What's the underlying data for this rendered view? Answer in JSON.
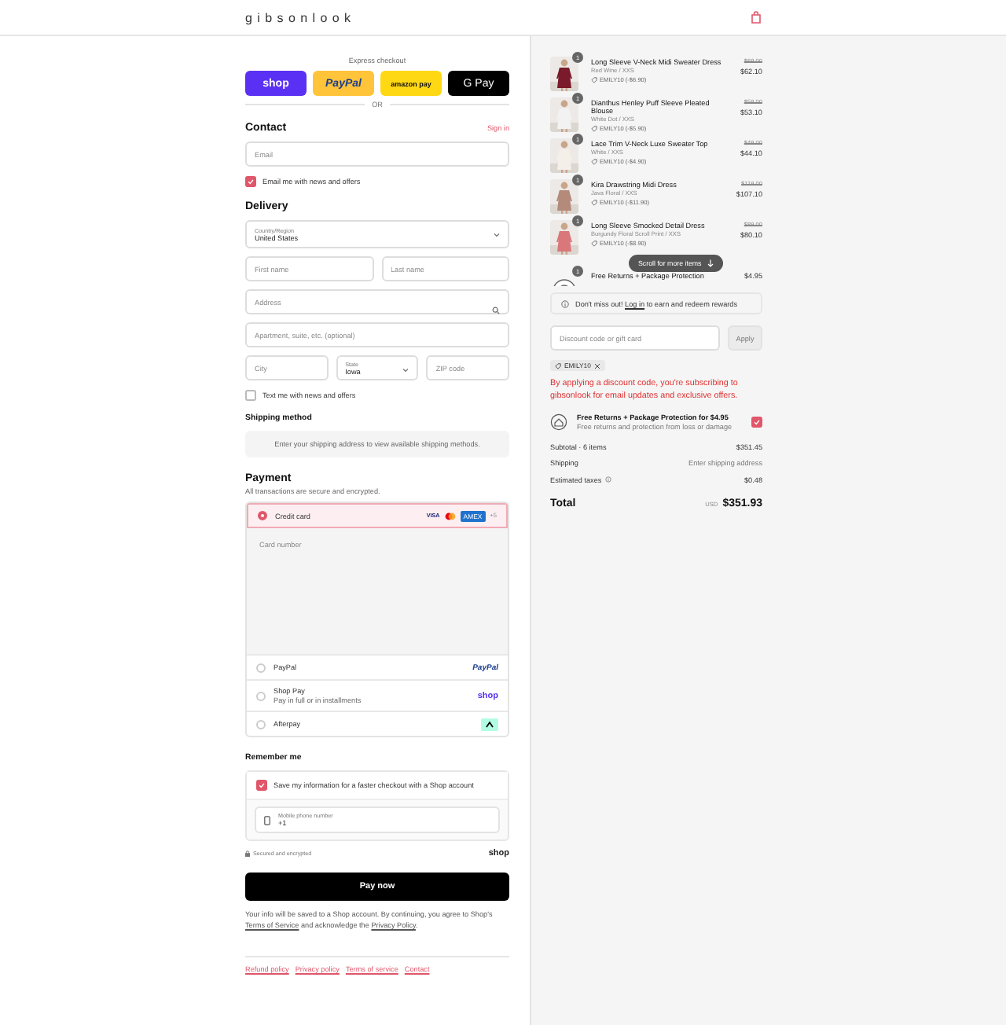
{
  "header": {
    "logo": "gibsonlook"
  },
  "express": {
    "title": "Express checkout",
    "or": "OR",
    "buttons": [
      {
        "kind": "shop",
        "label": "shop"
      },
      {
        "kind": "paypal",
        "label": "PayPal"
      },
      {
        "kind": "amazon",
        "label": "amazon pay"
      },
      {
        "kind": "gpay",
        "label": "G Pay"
      }
    ]
  },
  "contact": {
    "title": "Contact",
    "sign_in": "Sign in",
    "email": {
      "placeholder": "Email"
    },
    "news": {
      "label": "Email me with news and offers",
      "checked": true
    }
  },
  "delivery": {
    "title": "Delivery",
    "country": {
      "label": "Country/Region",
      "value": "United States"
    },
    "first_name": {
      "placeholder": "First name"
    },
    "last_name": {
      "placeholder": "Last name"
    },
    "address": {
      "placeholder": "Address"
    },
    "apartment": {
      "placeholder": "Apartment, suite, etc. (optional)"
    },
    "city": {
      "placeholder": "City"
    },
    "state": {
      "label": "State",
      "value": "Iowa"
    },
    "zip": {
      "placeholder": "ZIP code"
    },
    "text_news": {
      "label": "Text me with news and offers",
      "checked": false
    }
  },
  "shipping": {
    "title": "Shipping method",
    "message": "Enter your shipping address to view available shipping methods."
  },
  "payment": {
    "title": "Payment",
    "subtitle": "All transactions are secure and encrypted.",
    "methods": [
      {
        "kind": "card",
        "label": "Credit card",
        "selected": true,
        "card_number": {
          "placeholder": "Card number"
        },
        "brands": [
          {
            "kind": "visa",
            "label": "VISA"
          },
          {
            "kind": "mastercard"
          },
          {
            "kind": "amex",
            "label": "AMEX"
          }
        ],
        "more": "+5"
      },
      {
        "kind": "paypal",
        "label": "PayPal",
        "selected": false,
        "logo": "PayPal"
      },
      {
        "kind": "shoppay",
        "label": "Shop Pay",
        "sublabel": "Pay in full or in installments",
        "selected": false,
        "logo": "shop"
      },
      {
        "kind": "afterpay",
        "label": "Afterpay",
        "selected": false
      }
    ]
  },
  "remember": {
    "title": "Remember me",
    "save": {
      "label": "Save my information for a faster checkout with a Shop account",
      "checked": true
    },
    "phone": {
      "label": "Mobile phone number",
      "value": "+1"
    },
    "secure": "Secured and encrypted",
    "logo": "shop"
  },
  "pay_button": "Pay now",
  "legal": {
    "before": "Your info will be saved to a Shop account. By continuing, you agree to Shop's ",
    "terms": "Terms of Service",
    "middle": " and acknowledge the ",
    "privacy": "Privacy Policy",
    "after": "."
  },
  "footer_links": [
    "Refund policy",
    "Privacy policy",
    "Terms of service",
    "Contact"
  ],
  "summary": {
    "items": [
      {
        "kind": "product",
        "color": "#7a1a2a",
        "quantity": "1",
        "title": "Long Sleeve V-Neck Midi Sweater Dress",
        "variant": "Red Wine / XXS",
        "discount": "EMILY10 (-$6.90)",
        "original": "$69.00",
        "price": "$62.10"
      },
      {
        "kind": "product",
        "color": "#f2f2f2",
        "quantity": "1",
        "title": "Dianthus Henley Puff Sleeve Pleated Blouse",
        "variant": "White Dot / XXS",
        "discount": "EMILY10 (-$5.90)",
        "original": "$59.00",
        "price": "$53.10"
      },
      {
        "kind": "product",
        "color": "#f4efe8",
        "quantity": "1",
        "title": "Lace Trim V-Neck Luxe Sweater Top",
        "variant": "White / XXS",
        "discount": "EMILY10 (-$4.90)",
        "original": "$49.00",
        "price": "$44.10"
      },
      {
        "kind": "product",
        "color": "#b48a7a",
        "quantity": "1",
        "title": "Kira Drawstring Midi Dress",
        "variant": "Java Floral / XXS",
        "discount": "EMILY10 (-$11.90)",
        "original": "$119.00",
        "price": "$107.10"
      },
      {
        "kind": "product",
        "color": "#d9777a",
        "quantity": "1",
        "title": "Long Sleeve Smocked Detail Dress",
        "variant": "Burgundy Floral Scroll Print / XXS",
        "discount": "EMILY10 (-$8.90)",
        "original": "$89.00",
        "price": "$80.10"
      },
      {
        "kind": "protection",
        "quantity": "1",
        "title": "Free Returns + Package Protection",
        "price": "$4.95"
      }
    ],
    "scroll_hint": "Scroll for more items",
    "rewards": {
      "before": "Don't miss out! ",
      "link": "Log in",
      "after": " to earn and redeem rewards"
    },
    "discount": {
      "placeholder": "Discount code or gift card",
      "button": "Apply"
    },
    "applied_code": "EMILY10",
    "notice": "By applying a discount code, you're subscribing to gibsonlook for email updates and exclusive offers.",
    "protection": {
      "title": "Free Returns + Package Protection for $4.95",
      "subtitle": "Free returns and protection from loss or damage",
      "checked": true
    },
    "rows": [
      {
        "kind": "plain",
        "label": "Subtotal · 6 items",
        "value": "$351.45"
      },
      {
        "kind": "muted",
        "label": "Shipping",
        "value": "Enter shipping address"
      },
      {
        "kind": "info",
        "label": "Estimated taxes",
        "value": "$0.48"
      }
    ],
    "total": {
      "label": "Total",
      "currency": "USD",
      "value": "$351.93"
    }
  }
}
